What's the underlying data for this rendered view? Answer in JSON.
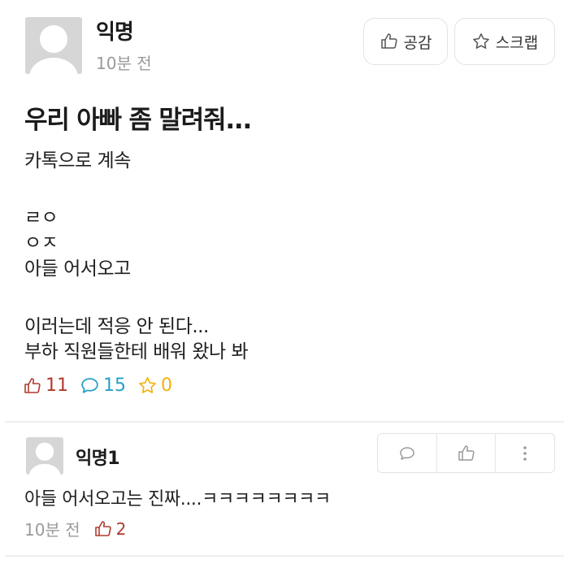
{
  "post": {
    "author": "익명",
    "time": "10분 전",
    "like_button_label": "공감",
    "scrap_button_label": "스크랩",
    "title": "우리 아빠 좀 말려줘...",
    "body_lines": [
      "카톡으로 계속",
      "ㄹㅇ",
      "ㅇㅈ",
      "아들 어서오고",
      "이러는데 적응 안 된다...",
      "부하 직원들한테 배워 왔나 봐"
    ],
    "stats": {
      "likes": "11",
      "comments": "15",
      "scraps": "0"
    },
    "colors": {
      "like": "#b03a2e",
      "comment": "#28a0c8",
      "scrap": "#f2b20c"
    }
  },
  "comment": {
    "author": "익명1",
    "text": "아들 어서오고는 진짜....ㅋㅋㅋㅋㅋㅋㅋㅋ",
    "time": "10분 전",
    "likes": "2",
    "actions": [
      "speech-bubble-icon",
      "thumbs-up-icon",
      "more-vertical-icon"
    ]
  }
}
